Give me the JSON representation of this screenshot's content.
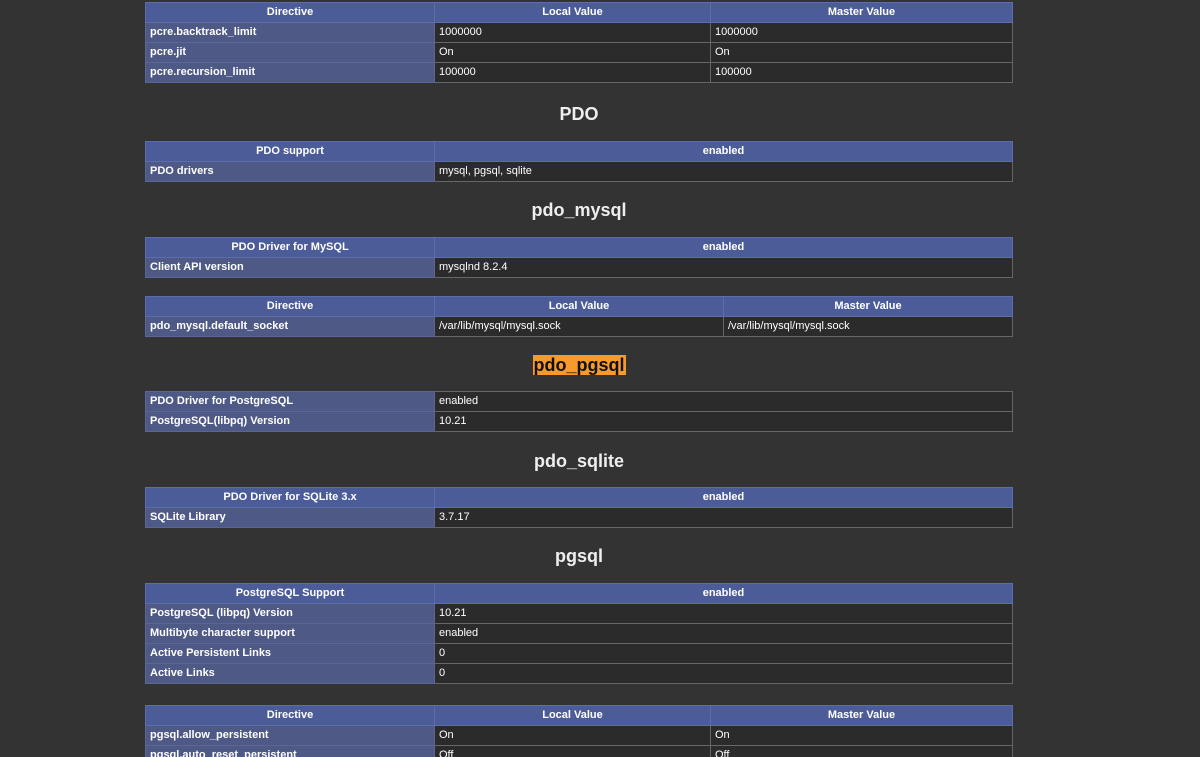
{
  "pcre_directives": {
    "headers": [
      "Directive",
      "Local Value",
      "Master Value"
    ],
    "rows": [
      [
        "pcre.backtrack_limit",
        "1000000",
        "1000000"
      ],
      [
        "pcre.jit",
        "On",
        "On"
      ],
      [
        "pcre.recursion_limit",
        "100000",
        "100000"
      ]
    ]
  },
  "pdo": {
    "title": "PDO",
    "header": [
      "PDO support",
      "enabled"
    ],
    "rows": [
      [
        "PDO drivers",
        "mysql, pgsql, sqlite"
      ]
    ]
  },
  "pdo_mysql": {
    "title": "pdo_mysql",
    "header": [
      "PDO Driver for MySQL",
      "enabled"
    ],
    "rows": [
      [
        "Client API version",
        "mysqlnd 8.2.4"
      ]
    ],
    "directives": {
      "headers": [
        "Directive",
        "Local Value",
        "Master Value"
      ],
      "rows": [
        [
          "pdo_mysql.default_socket",
          "/var/lib/mysql/mysql.sock",
          "/var/lib/mysql/mysql.sock"
        ]
      ]
    }
  },
  "pdo_pgsql": {
    "title": "pdo_pgsql",
    "highlight_color": "#f79a2b",
    "rows": [
      [
        "PDO Driver for PostgreSQL",
        "enabled"
      ],
      [
        "PostgreSQL(libpq) Version",
        "10.21"
      ]
    ]
  },
  "pdo_sqlite": {
    "title": "pdo_sqlite",
    "header": [
      "PDO Driver for SQLite 3.x",
      "enabled"
    ],
    "rows": [
      [
        "SQLite Library",
        "3.7.17"
      ]
    ]
  },
  "pgsql": {
    "title": "pgsql",
    "header": [
      "PostgreSQL Support",
      "enabled"
    ],
    "rows": [
      [
        "PostgreSQL (libpq) Version",
        "10.21"
      ],
      [
        "Multibyte character support",
        "enabled"
      ],
      [
        "Active Persistent Links",
        "0"
      ],
      [
        "Active Links",
        "0"
      ]
    ],
    "directives": {
      "headers": [
        "Directive",
        "Local Value",
        "Master Value"
      ],
      "rows": [
        [
          "pgsql.allow_persistent",
          "On",
          "On"
        ],
        [
          "pgsql.auto_reset_persistent",
          "Off",
          "Off"
        ]
      ]
    }
  },
  "colors": {
    "background": "#333333",
    "header_bg": "#4c5c99",
    "row_label_bg": "#4e5985",
    "value_bg": "#2b2b2b"
  }
}
